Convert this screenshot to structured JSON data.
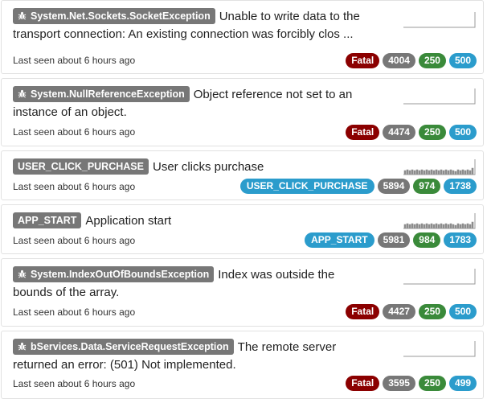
{
  "stacks": [
    {
      "type_label": "System.Net.Sockets.SocketException",
      "is_error": true,
      "message_line1": "Unable to write data to the",
      "message_line2": "transport connection: An existing connection was forcibly clos ...",
      "last_seen": "Last seen about 6 hours ago",
      "badges": [
        {
          "kind": "fatal",
          "text": "Fatal"
        },
        {
          "kind": "total",
          "text": "4004"
        },
        {
          "kind": "users",
          "text": "250"
        },
        {
          "kind": "sessions",
          "text": "500"
        }
      ],
      "sparkline": "empty"
    },
    {
      "type_label": "System.NullReferenceException",
      "is_error": true,
      "message_line1": "Object reference not set to an",
      "message_line2": "instance of an object.",
      "last_seen": "Last seen about 6 hours ago",
      "badges": [
        {
          "kind": "fatal",
          "text": "Fatal"
        },
        {
          "kind": "total",
          "text": "4474"
        },
        {
          "kind": "users",
          "text": "250"
        },
        {
          "kind": "sessions",
          "text": "500"
        }
      ],
      "sparkline": "empty"
    },
    {
      "type_label": "USER_CLICK_PURCHASE",
      "is_error": false,
      "message_line1": "User clicks purchase",
      "message_line2": "",
      "last_seen": "Last seen about 6 hours ago",
      "badges": [
        {
          "kind": "tag",
          "text": "USER_CLICK_PURCHASE"
        },
        {
          "kind": "total",
          "text": "5894"
        },
        {
          "kind": "users",
          "text": "974"
        },
        {
          "kind": "sessions",
          "text": "1738"
        }
      ],
      "sparkline": "bars"
    },
    {
      "type_label": "APP_START",
      "is_error": false,
      "message_line1": "Application start",
      "message_line2": "",
      "last_seen": "Last seen about 6 hours ago",
      "badges": [
        {
          "kind": "tag",
          "text": "APP_START"
        },
        {
          "kind": "total",
          "text": "5981"
        },
        {
          "kind": "users",
          "text": "984"
        },
        {
          "kind": "sessions",
          "text": "1783"
        }
      ],
      "sparkline": "bars"
    },
    {
      "type_label": "System.IndexOutOfBoundsException",
      "is_error": true,
      "message_line1": "Index was outside the",
      "message_line2": "bounds of the array.",
      "last_seen": "Last seen about 6 hours ago",
      "badges": [
        {
          "kind": "fatal",
          "text": "Fatal"
        },
        {
          "kind": "total",
          "text": "4427"
        },
        {
          "kind": "users",
          "text": "250"
        },
        {
          "kind": "sessions",
          "text": "500"
        }
      ],
      "sparkline": "empty"
    },
    {
      "type_label": "bServices.Data.ServiceRequestException",
      "is_error": true,
      "message_line1": "The remote server",
      "message_line2": "returned an error: (501) Not implemented.",
      "last_seen": "Last seen about 6 hours ago",
      "badges": [
        {
          "kind": "fatal",
          "text": "Fatal"
        },
        {
          "kind": "total",
          "text": "3595"
        },
        {
          "kind": "users",
          "text": "250"
        },
        {
          "kind": "sessions",
          "text": "499"
        }
      ],
      "sparkline": "empty"
    }
  ],
  "colors": {
    "type_label_bg": "#777777",
    "fatal": "#8b0000",
    "total": "#777777",
    "users": "#3a8a3a",
    "sessions": "#2b9ccc"
  },
  "icons": {
    "error": "bug-icon"
  }
}
